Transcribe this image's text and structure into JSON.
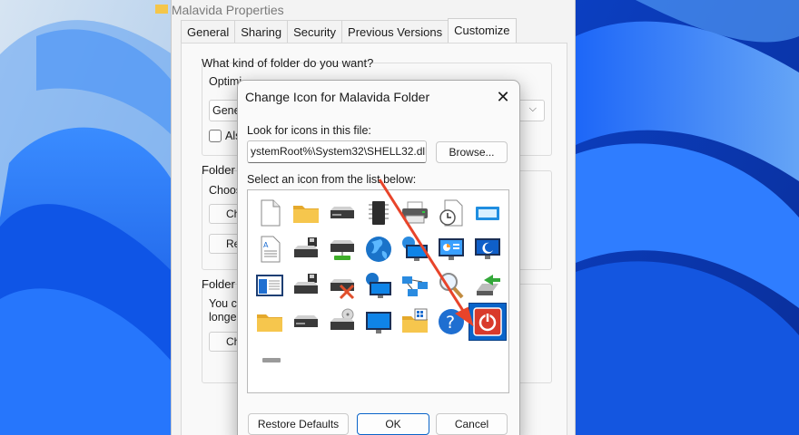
{
  "properties_window": {
    "title": "Malavida Properties",
    "tabs": [
      "General",
      "Sharing",
      "Security",
      "Previous Versions",
      "Customize"
    ],
    "active_tab": "Customize",
    "question": "What kind of folder do you want?",
    "optimize_label": "Optimi",
    "optimize_value": "Gene",
    "also_label": "Als",
    "folder_pictures_label": "Folder",
    "choose_text": "Choos",
    "choose_btn": "Ch",
    "restore_btn": "Re",
    "folder_icons_label": "Folder",
    "you_can_text": "You ca",
    "longer_text": "longer",
    "change_btn": "Ch"
  },
  "dialog": {
    "title": "Change Icon for Malavida Folder",
    "look_label": "Look for icons in this file:",
    "path_value": "ystemRoot%\\System32\\SHELL32.dll",
    "browse_button": "Browse...",
    "select_label": "Select an icon from the list below:",
    "icons": [
      "blank-file-icon",
      "folder-icon",
      "drive-icon",
      "chip-icon",
      "printer-icon",
      "clock-file-icon",
      "app-window-icon",
      "text-file-icon",
      "floppy-drive-icon",
      "network-drive-icon",
      "globe-icon",
      "network-monitor-icon",
      "control-panel-icon",
      "sleep-monitor-icon",
      "window-document-icon",
      "floppy-icon",
      "removed-drive-icon",
      "globe-monitor-icon",
      "network-icon",
      "search-icon",
      "move-arrow-icon",
      "open-folder-icon",
      "drive-icon",
      "cd-drive-icon",
      "monitor-icon",
      "folder-grid-icon",
      "help-icon",
      "power-icon",
      "small-drive-icon"
    ],
    "selected_icon": "power-icon",
    "restore_defaults_button": "Restore Defaults",
    "ok_button": "OK",
    "cancel_button": "Cancel",
    "close_icon": "close-icon",
    "accent_color": "#0a64c9",
    "arrow_color": "#e8442a"
  }
}
